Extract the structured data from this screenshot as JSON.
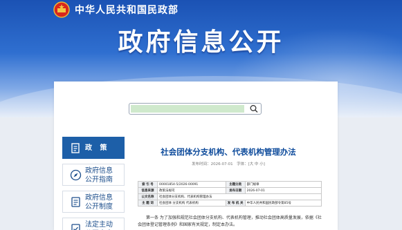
{
  "header": {
    "ministry": "中华人民共和国民政部",
    "title": "政府信息公开"
  },
  "search": {
    "value": "",
    "placeholder": ""
  },
  "sidebar": {
    "items": [
      {
        "label": "政  策"
      },
      {
        "label": "政府信息\n公开指南"
      },
      {
        "label": "政府信息\n公开制度"
      },
      {
        "label": "法定主动\n公开内容"
      }
    ]
  },
  "document": {
    "title": "社会团体分支机构、代表机构管理办法",
    "meta": "发布时间：2026-07-01　字体：[大 中 小]",
    "table": {
      "rows": [
        [
          "索 引 号",
          "00001854-5/2026-00091",
          "主题分类",
          "部门规章"
        ],
        [
          "信息来源",
          "政策法规司",
          "发布日期",
          "2026-07-01"
        ],
        [
          "公文名称",
          "社会团体分支机构、代表机构管理办法",
          "",
          ""
        ],
        [
          "主 题 词",
          "社会团体 分支机构 代表机构",
          "发 布 机 关",
          "中华人民共和国民政部令第85号"
        ]
      ]
    },
    "body": "第一条 为了加强和规范社会团体分支机构、代表机构管理，推动社会团体高质量发展，依据《社会团体登记管理条例》和国家有关规定，制定本办法。"
  },
  "colors": {
    "banner": "#1b52b4",
    "accent": "#1d5fa8",
    "title_blue": "#0f4c9c"
  }
}
